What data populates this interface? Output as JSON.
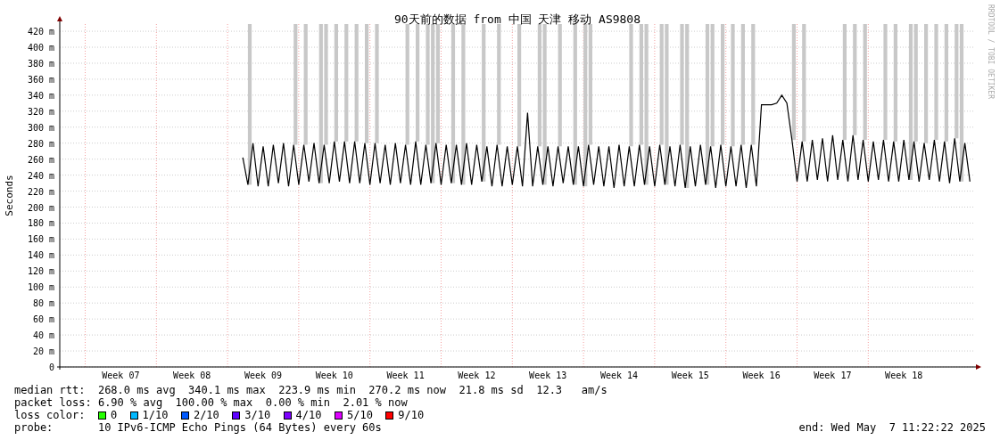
{
  "graph": {
    "credit": "RRDTOOL / TOBI OETIKER",
    "chart_data": {
      "type": "line",
      "title": "90天前的数据 from 中国 天津 移动 AS9808",
      "ylabel": "Seconds",
      "ylim": [
        0,
        429
      ],
      "yticks": [
        {
          "value": 0,
          "label": "0"
        },
        {
          "value": 20,
          "label": "20 m"
        },
        {
          "value": 40,
          "label": "40 m"
        },
        {
          "value": 60,
          "label": "60 m"
        },
        {
          "value": 80,
          "label": "80 m"
        },
        {
          "value": 100,
          "label": "100 m"
        },
        {
          "value": 120,
          "label": "120 m"
        },
        {
          "value": 140,
          "label": "140 m"
        },
        {
          "value": 160,
          "label": "160 m"
        },
        {
          "value": 180,
          "label": "180 m"
        },
        {
          "value": 200,
          "label": "200 m"
        },
        {
          "value": 220,
          "label": "220 m"
        },
        {
          "value": 240,
          "label": "240 m"
        },
        {
          "value": 260,
          "label": "260 m"
        },
        {
          "value": 280,
          "label": "280 m"
        },
        {
          "value": 300,
          "label": "300 m"
        },
        {
          "value": 320,
          "label": "320 m"
        },
        {
          "value": 340,
          "label": "340 m"
        },
        {
          "value": 360,
          "label": "360 m"
        },
        {
          "value": 380,
          "label": "380 m"
        },
        {
          "value": 400,
          "label": "400 m"
        },
        {
          "value": 420,
          "label": "420 m"
        }
      ],
      "categories": [
        null,
        null,
        null,
        null,
        null,
        null,
        null,
        null,
        null,
        null,
        null,
        null,
        "Week 07",
        null,
        null,
        null,
        null,
        null,
        null,
        null,
        null,
        null,
        null,
        null,
        null,
        null,
        "Week 08",
        null,
        null,
        null,
        null,
        null,
        null,
        null,
        null,
        null,
        null,
        null,
        null,
        null,
        "Week 09",
        null,
        null,
        null,
        null,
        null,
        null,
        null,
        null,
        null,
        null,
        null,
        null,
        null,
        "Week 10",
        null,
        null,
        null,
        null,
        null,
        null,
        null,
        null,
        null,
        null,
        null,
        null,
        null,
        "Week 11",
        null,
        null,
        null,
        null,
        null,
        null,
        null,
        null,
        null,
        null,
        null,
        null,
        null,
        "Week 12",
        null,
        null,
        null,
        null,
        null,
        null,
        null,
        null,
        null,
        null,
        null,
        null,
        null,
        "Week 13",
        null,
        null,
        null,
        null,
        null,
        null,
        null,
        null,
        null,
        null,
        null,
        null,
        null,
        "Week 14",
        null,
        null,
        null,
        null,
        null,
        null,
        null,
        null,
        null,
        null,
        null,
        null,
        null,
        "Week 15",
        null,
        null,
        null,
        null,
        null,
        null,
        null,
        null,
        null,
        null,
        null,
        null,
        null,
        "Week 16",
        null,
        null,
        null,
        null,
        null,
        null,
        null,
        null,
        null,
        null,
        null,
        null,
        null,
        "Week 17",
        null,
        null,
        null,
        null,
        null,
        null,
        null,
        null,
        null,
        null,
        null,
        null,
        null,
        "Week 18",
        null,
        null,
        null,
        null,
        null,
        null,
        null,
        null,
        null,
        null,
        null,
        null,
        null
      ],
      "series": [
        {
          "color": "#000000",
          "values": [
            null,
            null,
            null,
            null,
            null,
            null,
            null,
            null,
            null,
            null,
            null,
            null,
            null,
            null,
            null,
            null,
            null,
            null,
            null,
            null,
            null,
            null,
            null,
            null,
            null,
            null,
            null,
            null,
            null,
            null,
            null,
            null,
            null,
            null,
            null,
            null,
            262,
            228,
            280,
            226,
            276,
            226,
            278,
            230,
            280,
            226,
            278,
            228,
            278,
            232,
            280,
            230,
            278,
            230,
            282,
            232,
            282,
            230,
            282,
            230,
            280,
            228,
            280,
            230,
            278,
            228,
            280,
            230,
            278,
            228,
            282,
            228,
            278,
            230,
            280,
            228,
            278,
            230,
            278,
            228,
            280,
            228,
            278,
            232,
            276,
            226,
            278,
            226,
            276,
            228,
            276,
            226,
            318,
            226,
            276,
            228,
            276,
            226,
            276,
            230,
            276,
            228,
            276,
            226,
            278,
            228,
            276,
            226,
            276,
            224,
            278,
            226,
            276,
            226,
            278,
            228,
            276,
            226,
            278,
            228,
            276,
            226,
            278,
            224,
            276,
            226,
            278,
            228,
            276,
            224,
            278,
            226,
            276,
            226,
            278,
            224,
            278,
            226,
            328,
            328,
            328,
            330,
            340,
            330,
            284,
            232,
            282,
            232,
            284,
            234,
            286,
            232,
            290,
            234,
            284,
            232,
            290,
            234,
            284,
            232,
            282,
            234,
            284,
            232,
            282,
            232,
            284,
            234,
            282,
            232,
            280,
            234,
            284,
            232,
            282,
            230,
            286,
            232,
            280,
            232
          ]
        }
      ],
      "grid": true
    }
  },
  "legend": [
    {
      "kind": "stats",
      "label": "median rtt:",
      "text": "268.0 ms avg  340.1 ms max  223.9 ms min  270.2 ms now  21.8 ms sd  12.3   am/s"
    },
    {
      "kind": "stats",
      "label": "packet loss:",
      "text": "6.90 % avg  100.00 % max  0.00 % min  2.01 % now"
    },
    {
      "kind": "colors",
      "label": "loss color:",
      "items": [
        {
          "label": "0",
          "color": "#26ff00"
        },
        {
          "label": "1/10",
          "color": "#00b8ff"
        },
        {
          "label": "2/10",
          "color": "#0059ff"
        },
        {
          "label": "3/10",
          "color": "#5e00ff"
        },
        {
          "label": "4/10",
          "color": "#7e00ff"
        },
        {
          "label": "5/10",
          "color": "#dd00ff"
        },
        {
          "label": "9/10",
          "color": "#ff0000"
        }
      ]
    },
    {
      "kind": "probe",
      "label": "probe:",
      "text": "10 IPv6-ICMP Echo Pings (64 Bytes) every 60s",
      "end": "end: Wed May  7 11:22:22 2025"
    }
  ]
}
